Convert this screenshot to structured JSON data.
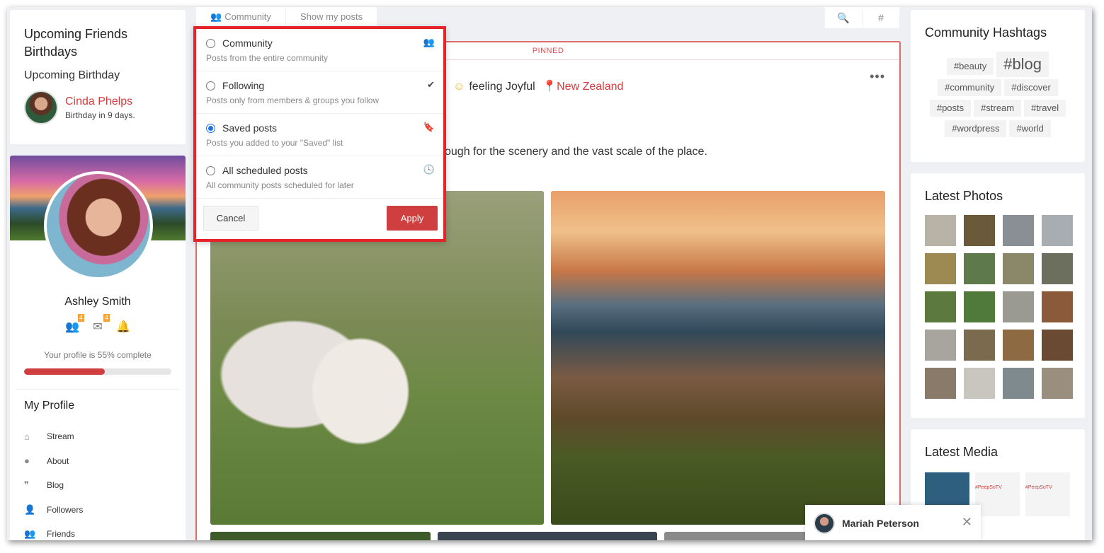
{
  "birthdays": {
    "title": "Upcoming Friends Birthdays",
    "subtitle": "Upcoming Birthday",
    "person": {
      "name": "Cinda Phelps",
      "note": "Birthday in 9 days."
    }
  },
  "profile": {
    "name": "Ashley Smith",
    "badges": {
      "friends": "4",
      "messages": "4"
    },
    "complete_text": "Your profile is 55% complete",
    "complete_fraction": 0.55,
    "section_title": "My Profile",
    "menu": [
      {
        "icon": "home-icon",
        "label": "Stream"
      },
      {
        "icon": "user-circle-icon",
        "label": "About"
      },
      {
        "icon": "quote-icon",
        "label": "Blog"
      },
      {
        "icon": "user-check-icon",
        "label": "Followers"
      },
      {
        "icon": "users-icon",
        "label": "Friends"
      }
    ]
  },
  "tabs": {
    "community": "Community",
    "my_posts": "Show my posts"
  },
  "toolbar": {
    "search_icon": "🔍",
    "hash_icon": "#"
  },
  "post": {
    "pinned": "PINNED",
    "mood": "feeling Joyful",
    "location": "New Zealand",
    "text_fragment": "ough for the scenery and the vast scale of the place.",
    "more": "•••"
  },
  "filter": {
    "options": [
      {
        "label": "Community",
        "desc": "Posts from the entire community",
        "icon": "users-icon",
        "checked": false
      },
      {
        "label": "Following",
        "desc": "Posts only from members & groups you follow",
        "icon": "check-circle-icon",
        "checked": false
      },
      {
        "label": "Saved posts",
        "desc": "Posts you added to your \"Saved\" list",
        "icon": "bookmark-icon",
        "checked": true
      },
      {
        "label": "All scheduled posts",
        "desc": "All community posts scheduled for later",
        "icon": "clock-icon",
        "checked": false
      }
    ],
    "cancel": "Cancel",
    "apply": "Apply"
  },
  "hashtags": {
    "title": "Community Hashtags",
    "tags": [
      "#beauty",
      "#blog",
      "#community",
      "#discover",
      "#posts",
      "#stream",
      "#travel",
      "#wordpress",
      "#world"
    ]
  },
  "photos": {
    "title": "Latest Photos"
  },
  "media": {
    "title": "Latest Media",
    "items": [
      "#PeepSoTV",
      "#PeepSoTV"
    ]
  },
  "chat": {
    "name": "Mariah Peterson",
    "close": "✕"
  },
  "colors": {
    "accent": "#d03f3f",
    "highlight_border": "#e5232a",
    "link": "#d83c3c"
  }
}
